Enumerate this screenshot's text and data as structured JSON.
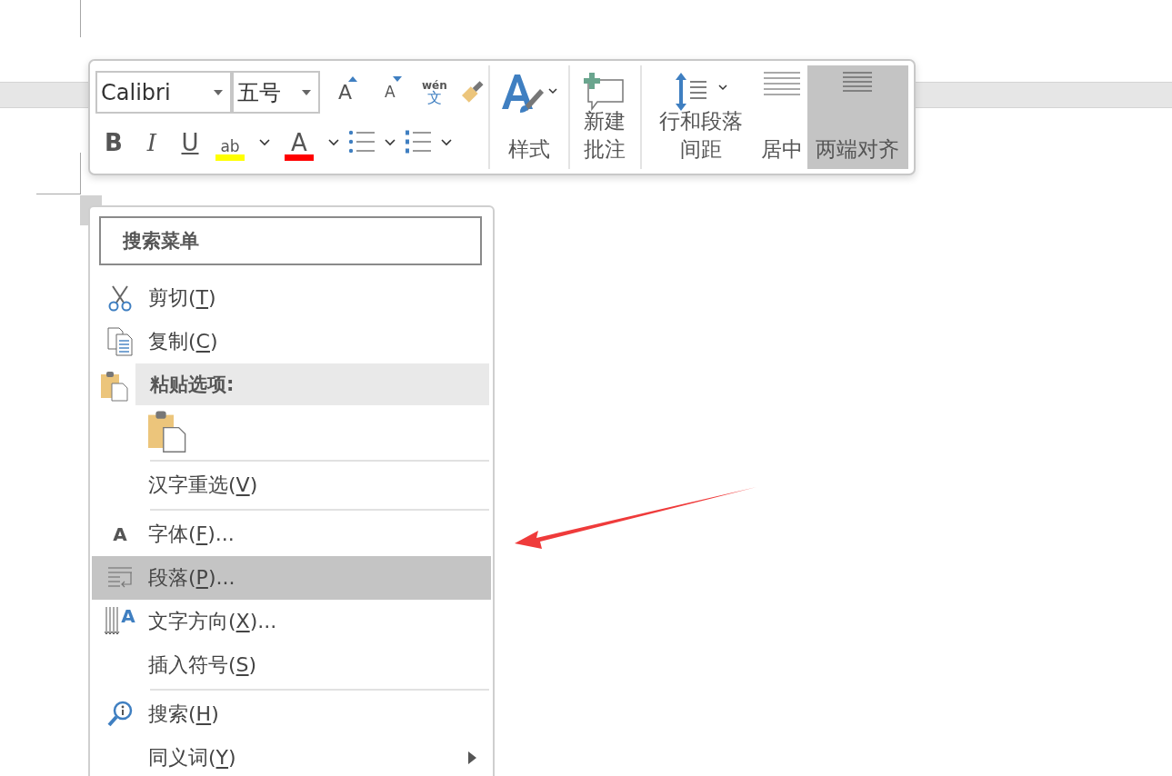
{
  "toolbar": {
    "font_name": "Calibri",
    "font_size": "五号",
    "grow_font": "A",
    "shrink_font": "A",
    "phonetic": {
      "pinyin": "wén",
      "hanzi": "文"
    },
    "bold": "B",
    "italic": "I",
    "underline": "U",
    "highlight": {
      "glyph": "ab",
      "color": "#ffff00"
    },
    "font_color": {
      "glyph": "A",
      "color": "#ff0000"
    },
    "large_buttons": [
      {
        "kind": "styles",
        "label": "样式",
        "selected": false
      },
      {
        "kind": "comment",
        "label": "新建批注",
        "selected": false
      },
      {
        "kind": "spacing",
        "label": "行和段落间距",
        "selected": false
      },
      {
        "kind": "center",
        "label": "居中",
        "selected": false
      },
      {
        "kind": "justify",
        "label": "两端对齐",
        "selected": true
      }
    ]
  },
  "context_menu": {
    "search": {
      "placeholder": "搜索菜单"
    },
    "items": [
      {
        "kind": "cut",
        "before": "剪切(",
        "key": "T",
        "after": ")",
        "selected": false,
        "submenu": false
      },
      {
        "kind": "copy",
        "before": "复制(",
        "key": "C",
        "after": ")",
        "selected": false,
        "submenu": false
      },
      {
        "kind": "paste-header",
        "label": "粘贴选项:"
      },
      {
        "kind": "paste-option"
      },
      {
        "kind": "separator"
      },
      {
        "kind": "plain",
        "before": "汉字重选(",
        "key": "V",
        "after": ")",
        "selected": false,
        "submenu": false
      },
      {
        "kind": "separator"
      },
      {
        "kind": "font",
        "icon_glyph": "A",
        "before": "字体(",
        "key": "F",
        "after": ")...",
        "selected": false,
        "submenu": false
      },
      {
        "kind": "paragraph",
        "before": "段落(",
        "key": "P",
        "after": ")...",
        "selected": true,
        "submenu": false
      },
      {
        "kind": "direction",
        "icon_glyph": "A",
        "before": "文字方向(",
        "key": "X",
        "after": ")...",
        "selected": false,
        "submenu": false
      },
      {
        "kind": "plain",
        "before": "插入符号(",
        "key": "S",
        "after": ")",
        "selected": false,
        "submenu": false
      },
      {
        "kind": "separator"
      },
      {
        "kind": "lookup",
        "before": "搜索(",
        "key": "H",
        "after": ")",
        "selected": false,
        "submenu": false
      },
      {
        "kind": "plain",
        "before": "同义词(",
        "key": "Y",
        "after": ")",
        "selected": false,
        "submenu": true
      }
    ]
  }
}
